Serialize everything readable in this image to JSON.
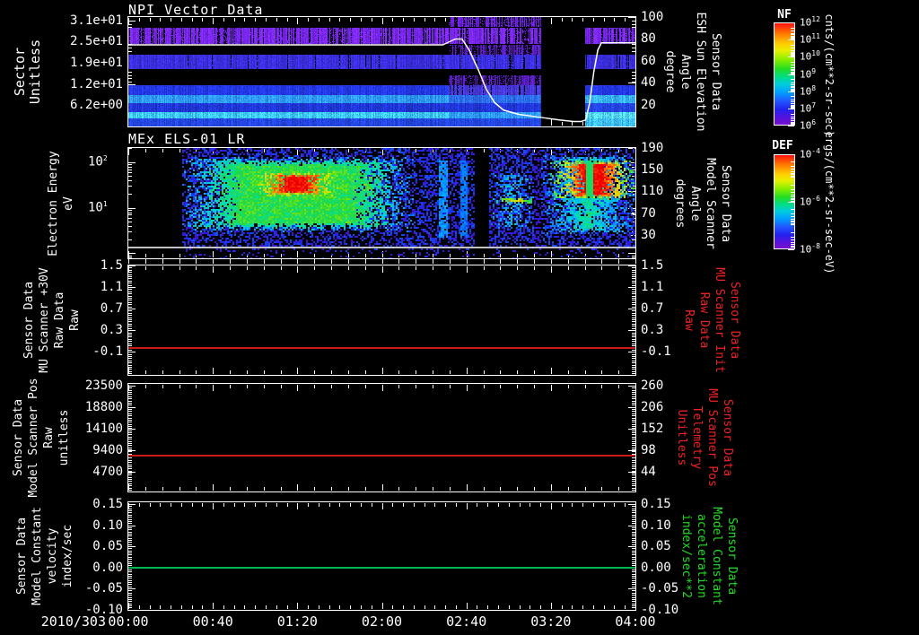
{
  "app": {
    "background": "#000000",
    "text_color": "#ffffff"
  },
  "xaxis": {
    "date_label": "2010/303",
    "tick_labels": [
      "00:00",
      "00:40",
      "01:20",
      "02:00",
      "02:40",
      "03:20",
      "04:00"
    ]
  },
  "chart_data": [
    {
      "type": "heatmap",
      "title": "NPI Vector Data",
      "ylabel_lines": [
        "Sector",
        "Unitless"
      ],
      "left_ticks": [
        {
          "label": "3.1e+01",
          "frac": 0.031
        },
        {
          "label": "2.5e+01",
          "frac": 0.225
        },
        {
          "label": "1.9e+01",
          "frac": 0.419
        },
        {
          "label": "1.2e+01",
          "frac": 0.612
        },
        {
          "label": "6.2e+00",
          "frac": 0.806
        }
      ],
      "right_axis": {
        "color": "#ffffff",
        "label_lines": [
          "Sensor Data",
          "ESH Sun Elevation",
          "Angle",
          "degree"
        ],
        "ticks": [
          {
            "label": "100",
            "frac": 0.0
          },
          {
            "label": "80",
            "frac": 0.2
          },
          {
            "label": "60",
            "frac": 0.4
          },
          {
            "label": "40",
            "frac": 0.6
          },
          {
            "label": "20",
            "frac": 0.8
          }
        ]
      },
      "overlay_line": {
        "color": "#ffffff",
        "axis": "right (degrees 0-100)",
        "points": [
          [
            0,
            74.5
          ],
          [
            0.62,
            74.5
          ],
          [
            0.645,
            80
          ],
          [
            0.658,
            80
          ],
          [
            0.672,
            70
          ],
          [
            0.69,
            52
          ],
          [
            0.706,
            34
          ],
          [
            0.722,
            22
          ],
          [
            0.74,
            15
          ],
          [
            0.77,
            11
          ],
          [
            0.81,
            8.5
          ],
          [
            0.85,
            6
          ],
          [
            0.878,
            4.5
          ],
          [
            0.893,
            4.5
          ],
          [
            0.902,
            6
          ],
          [
            0.91,
            22
          ],
          [
            0.918,
            50
          ],
          [
            0.926,
            70
          ],
          [
            0.933,
            76.5
          ],
          [
            1.0,
            76.5
          ]
        ]
      },
      "no_data_gaps": [
        [
          0.814,
          0.902
        ]
      ],
      "bands_regions": [
        {
          "t0": 0.0,
          "t1": 0.632,
          "bands": [
            {
              "y0": 0.105,
              "y1": 0.238,
              "c": "#7a26f2",
              "sp": 0.28
            },
            {
              "y0": 0.352,
              "y1": 0.475,
              "c": "#3b2ede",
              "sp": 0.05
            },
            {
              "y0": 0.623,
              "y1": 0.721,
              "c": "#2438ea",
              "sp": 0
            },
            {
              "y0": 0.721,
              "y1": 0.787,
              "c": "#2e9bff",
              "sp": 0
            },
            {
              "y0": 0.787,
              "y1": 0.869,
              "c": "#2036d8",
              "sp": 0
            },
            {
              "y0": 0.869,
              "y1": 0.934,
              "c": "#3ecaff",
              "sp": 0
            },
            {
              "y0": 0.934,
              "y1": 1.0,
              "c": "#2346e2",
              "sp": 0
            }
          ]
        },
        {
          "t0": 0.632,
          "t1": 0.814,
          "bands": [
            {
              "y0": 0.0,
              "y1": 0.09,
              "c": "#6a1fd8",
              "sp": 0.5
            },
            {
              "y0": 0.105,
              "y1": 0.238,
              "c": "#7a26f2",
              "sp": 0.32
            },
            {
              "y0": 0.26,
              "y1": 0.34,
              "c": "#5a1cc0",
              "sp": 0.55
            },
            {
              "y0": 0.352,
              "y1": 0.475,
              "c": "#3b2ede",
              "sp": 0.12
            },
            {
              "y0": 0.54,
              "y1": 0.62,
              "c": "#5a1cc0",
              "sp": 0.6
            },
            {
              "y0": 0.623,
              "y1": 0.721,
              "c": "#4636d8",
              "sp": 0.15
            },
            {
              "y0": 0.721,
              "y1": 0.787,
              "c": "#2c6cee",
              "sp": 0
            },
            {
              "y0": 0.787,
              "y1": 0.869,
              "c": "#2036d8",
              "sp": 0
            },
            {
              "y0": 0.869,
              "y1": 0.934,
              "c": "#2e9bff",
              "sp": 0
            },
            {
              "y0": 0.934,
              "y1": 1.0,
              "c": "#2346e2",
              "sp": 0
            }
          ]
        },
        {
          "t0": 0.902,
          "t1": 1.0,
          "bands": [
            {
              "y0": 0.105,
              "y1": 0.238,
              "c": "#7a26f2",
              "sp": 0.28
            },
            {
              "y0": 0.352,
              "y1": 0.475,
              "c": "#3b2ede",
              "sp": 0.05
            },
            {
              "y0": 0.623,
              "y1": 0.721,
              "c": "#2438ea",
              "sp": 0
            },
            {
              "y0": 0.721,
              "y1": 0.787,
              "c": "#38b6ff",
              "sp": 0
            },
            {
              "y0": 0.787,
              "y1": 0.869,
              "c": "#2546ea",
              "sp": 0
            },
            {
              "y0": 0.869,
              "y1": 0.934,
              "c": "#55dcff",
              "sp": 0
            },
            {
              "y0": 0.934,
              "y1": 1.0,
              "c": "#40c4ff",
              "sp": 0
            }
          ]
        }
      ],
      "colorbar": {
        "name": "NF",
        "unit": "cnts/(cm**2-sr-sec)",
        "tick_exps": [
          "12",
          "11",
          "10",
          "9",
          "8",
          "7",
          "6"
        ],
        "decades": 6
      }
    },
    {
      "type": "heatmap",
      "title": "MEx ELS-01 LR",
      "ylabel_lines": [
        "Electron Energy",
        "eV"
      ],
      "left_ticks": [
        {
          "base": "10",
          "exp": "2",
          "frac": 0.128
        },
        {
          "base": "10",
          "exp": "1",
          "frac": 0.541
        }
      ],
      "log_axis": {
        "top": 2.31,
        "bottom": -0.11
      },
      "right_axis": {
        "color": "#ffffff",
        "label_lines": [
          "Sensor Data",
          "Model Scanner",
          "Angle",
          "degrees"
        ],
        "ticks": [
          {
            "label": "190",
            "frac": 0.0
          },
          {
            "label": "150",
            "frac": 0.197
          },
          {
            "label": "110",
            "frac": 0.394
          },
          {
            "label": "70",
            "frac": 0.591
          },
          {
            "label": "30",
            "frac": 0.789
          }
        ]
      },
      "hline": {
        "frac": 0.902,
        "color": "#ffffff"
      },
      "features": [
        {
          "k": "nodata",
          "t0": 0.0,
          "t1": 0.103
        },
        {
          "k": "speck",
          "t0": 0.103,
          "t1": 1.0,
          "y0": 0.0,
          "y1": 0.88,
          "d": 0.45,
          "v0": 0.04,
          "v1": 0.22
        },
        {
          "k": "speck",
          "t0": 0.103,
          "t1": 1.0,
          "y0": 0.88,
          "y1": 1.0,
          "d": 0.12,
          "v0": 0.04,
          "v1": 0.18
        },
        {
          "k": "blob",
          "t0": 0.103,
          "t1": 0.56,
          "y0": 0.07,
          "y1": 0.75,
          "v": 0.58,
          "soft": 0.12
        },
        {
          "k": "blob",
          "t0": 0.235,
          "t1": 0.425,
          "y0": 0.2,
          "y1": 0.44,
          "v": 1.0,
          "soft": 0.08
        },
        {
          "k": "blob",
          "t0": 0.425,
          "t1": 0.505,
          "y0": 0.23,
          "y1": 0.42,
          "v": 0.85,
          "soft": 0.1
        },
        {
          "k": "vstripe",
          "t": 0.62,
          "w": 0.01,
          "y0": 0.1,
          "y1": 0.8,
          "v": 0.33
        },
        {
          "k": "vstripe",
          "t": 0.66,
          "w": 0.008,
          "y0": 0.1,
          "y1": 0.8,
          "v": 0.28
        },
        {
          "k": "cut",
          "t0": 0.683,
          "t1": 0.708,
          "y0": 0.0,
          "y1": 1.0,
          "vmax": -1
        },
        {
          "k": "blob",
          "t0": 0.708,
          "t1": 0.8,
          "y0": 0.22,
          "y1": 0.72,
          "v": 0.52,
          "soft": 0.1
        },
        {
          "k": "blob",
          "t0": 0.72,
          "t1": 0.8,
          "y0": 0.44,
          "y1": 0.5,
          "v": 0.8,
          "soft": 0.03
        },
        {
          "k": "cut",
          "t0": 0.8,
          "t1": 0.812,
          "y0": 0.0,
          "y1": 1.0,
          "vmax": 0.08
        },
        {
          "k": "blob",
          "t0": 0.812,
          "t1": 1.0,
          "y0": 0.05,
          "y1": 0.78,
          "v": 0.5,
          "soft": 0.1
        },
        {
          "k": "blob",
          "t0": 0.83,
          "t1": 1.0,
          "y0": 0.1,
          "y1": 0.46,
          "v": 1.0,
          "soft": 0.07
        },
        {
          "k": "cut",
          "t0": 0.9,
          "t1": 0.916,
          "y0": 0.0,
          "y1": 0.55,
          "vmax": 0.55
        }
      ],
      "colorbar": {
        "name": "DEF",
        "unit": "ergs/(cm**2-sr-sec-eV)",
        "tick_exps": [
          "-4",
          "-6",
          "-8"
        ],
        "decades": 4
      }
    },
    {
      "type": "line",
      "ylabel_lines": [
        "Sensor Data",
        "MU Scanner +30V",
        "Raw Data",
        "Raw"
      ],
      "left_ticks": [
        {
          "label": "1.5",
          "frac": 0.0
        },
        {
          "label": "1.1",
          "frac": 0.197
        },
        {
          "label": "0.7",
          "frac": 0.393
        },
        {
          "label": "0.3",
          "frac": 0.59
        },
        {
          "label": "-0.1",
          "frac": 0.787
        }
      ],
      "right_axis": {
        "color": "#ee2222",
        "label_lines": [
          "Sensor Data",
          "MU Scanner Init",
          "Raw Data",
          "Raw"
        ],
        "ticks": [
          {
            "label": "1.5",
            "frac": 0.0
          },
          {
            "label": "1.1",
            "frac": 0.197
          },
          {
            "label": "0.7",
            "frac": 0.393
          },
          {
            "label": "0.3",
            "frac": 0.59
          },
          {
            "label": "-0.1",
            "frac": 0.787
          }
        ]
      },
      "line": {
        "color": "#cc1a1a",
        "frac": 0.754,
        "approx_value": 0.0
      }
    },
    {
      "type": "line",
      "ylabel_lines": [
        "Sensor Data",
        "Model Scanner Pos",
        "Raw",
        "unitless"
      ],
      "left_ticks": [
        {
          "label": "23500",
          "frac": 0.017
        },
        {
          "label": "18800",
          "frac": 0.217
        },
        {
          "label": "14100",
          "frac": 0.417
        },
        {
          "label": "9400",
          "frac": 0.617
        },
        {
          "label": "4700",
          "frac": 0.817
        }
      ],
      "right_axis": {
        "color": "#ee2222",
        "label_lines": [
          "Sensor Data",
          "MU Scanner Pos",
          "Telemetry",
          "Unitless"
        ],
        "ticks": [
          {
            "label": "260",
            "frac": 0.017
          },
          {
            "label": "206",
            "frac": 0.217
          },
          {
            "label": "152",
            "frac": 0.417
          },
          {
            "label": "98",
            "frac": 0.617
          },
          {
            "label": "44",
            "frac": 0.817
          }
        ]
      },
      "line": {
        "color": "#cc1a1a",
        "frac": 0.667,
        "approx_value": 8200
      }
    },
    {
      "type": "line",
      "ylabel_lines": [
        "Sensor Data",
        "Model Constant",
        "velocity",
        "index/sec"
      ],
      "left_ticks": [
        {
          "label": "0.15",
          "frac": 0.017
        },
        {
          "label": "0.10",
          "frac": 0.213
        },
        {
          "label": "0.05",
          "frac": 0.41
        },
        {
          "label": "0.00",
          "frac": 0.607
        },
        {
          "label": "-0.05",
          "frac": 0.803
        },
        {
          "label": "-0.10",
          "frac": 1.0
        }
      ],
      "right_axis": {
        "color": "#22dd22",
        "label_lines": [
          "Sensor Data",
          "Model Constant",
          "acceleration",
          "index/sec**2"
        ],
        "ticks": [
          {
            "label": "0.15",
            "frac": 0.017
          },
          {
            "label": "0.10",
            "frac": 0.213
          },
          {
            "label": "0.05",
            "frac": 0.41
          },
          {
            "label": "0.00",
            "frac": 0.607
          },
          {
            "label": "-0.05",
            "frac": 0.803
          },
          {
            "label": "-0.10",
            "frac": 1.0
          }
        ]
      },
      "line": {
        "color": "#00b850",
        "frac": 0.607,
        "approx_value": 0.0
      }
    }
  ]
}
